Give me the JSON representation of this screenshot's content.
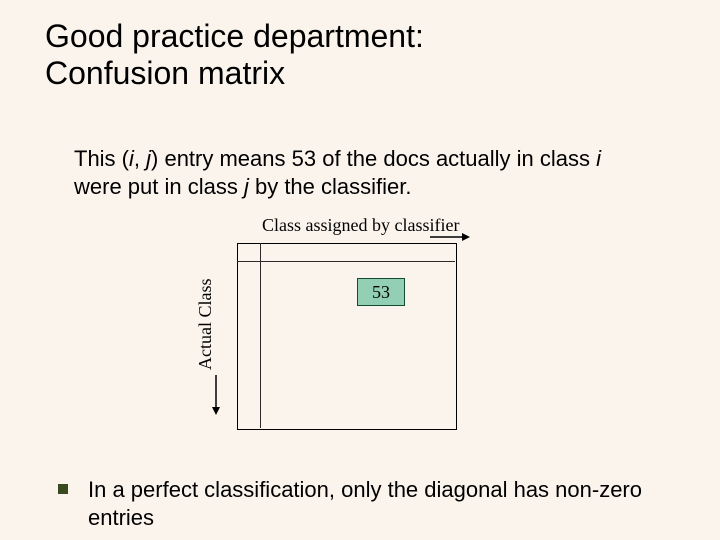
{
  "title_line1": "Good practice department:",
  "title_line2": "Confusion matrix",
  "desc_parts": {
    "p1": "This (",
    "i1": "i",
    "p2": ", ",
    "i2": "j",
    "p3": ") entry means 53 of the docs actually in class ",
    "i3": "i",
    "p4": " were put in class ",
    "i4": "j",
    "p5": " by the classifier."
  },
  "top_axis_label": "Class assigned by classifier",
  "left_axis_label": "Actual Class",
  "cell_value": "53",
  "bullet_text": "In a perfect classification, only the diagonal has non-zero entries"
}
